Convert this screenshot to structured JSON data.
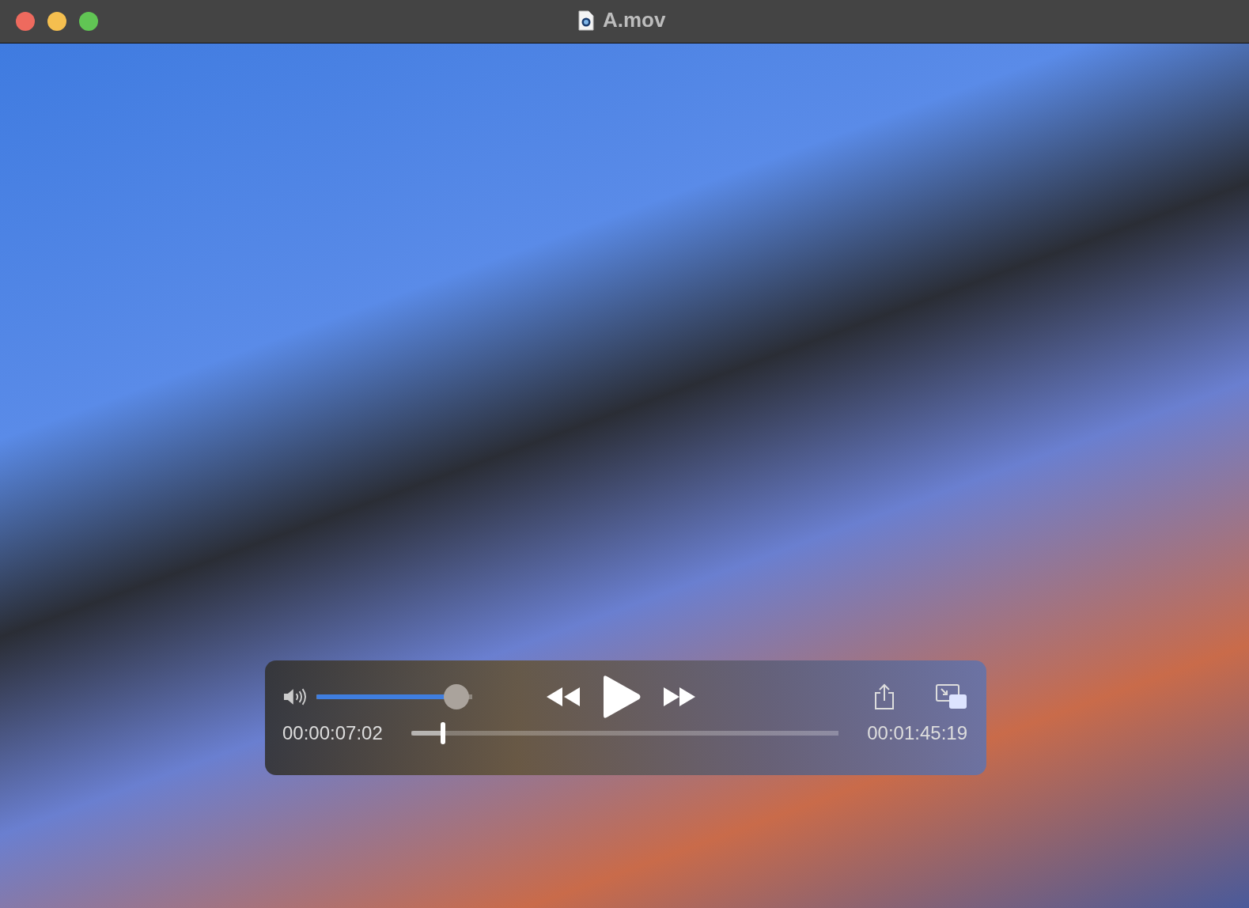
{
  "window": {
    "title": "A.mov"
  },
  "controls": {
    "volume": {
      "level": 0.9
    },
    "elapsed": "00:00:07:02",
    "remaining": "00:01:45:19",
    "scrubber": {
      "level": 0.075
    }
  }
}
